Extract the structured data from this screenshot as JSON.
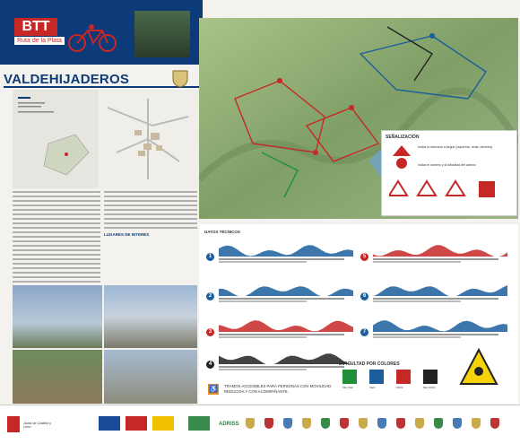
{
  "header": {
    "logo": "BTT",
    "subtitle": "Ruta de la Plata"
  },
  "title": "VALDEHIJADEROS",
  "sections": {
    "places": "LUGARES DE INTERÉS",
    "tech": "DATOS TÉCNICOS",
    "signage": "SEÑALIZACIÓN",
    "difficulty": "DIFICULTAD POR COLORES"
  },
  "signage": {
    "arrow_text": "Indica la dirección a seguir (izquierda, recta, derecha)",
    "number_text": "Indica el número y la dificultad del camino"
  },
  "accessibility": "TRAMOS ACCESIBLES PARA PERSONAS CON MOVILIDAD REDUCIDA Y CON ACOMPAÑANTE.",
  "profiles": [
    {
      "n": "1",
      "color": "#1b5e9b"
    },
    {
      "n": "2",
      "color": "#1b5e9b"
    },
    {
      "n": "3",
      "color": "#c62828"
    },
    {
      "n": "4",
      "color": "#222222"
    },
    {
      "n": "5",
      "color": "#c62828"
    },
    {
      "n": "6",
      "color": "#1b5e9b"
    },
    {
      "n": "7",
      "color": "#1b5e9b"
    }
  ],
  "difficulty_colors": [
    {
      "label": "Muy fácil",
      "color": "#1f8f3a"
    },
    {
      "label": "Fácil",
      "color": "#1b5e9b"
    },
    {
      "label": "Difícil",
      "color": "#c62828"
    },
    {
      "label": "Muy difícil",
      "color": "#222222"
    }
  ],
  "footer": {
    "jcyl": "Junta de Castilla y León",
    "adriss": "ADRISS"
  }
}
